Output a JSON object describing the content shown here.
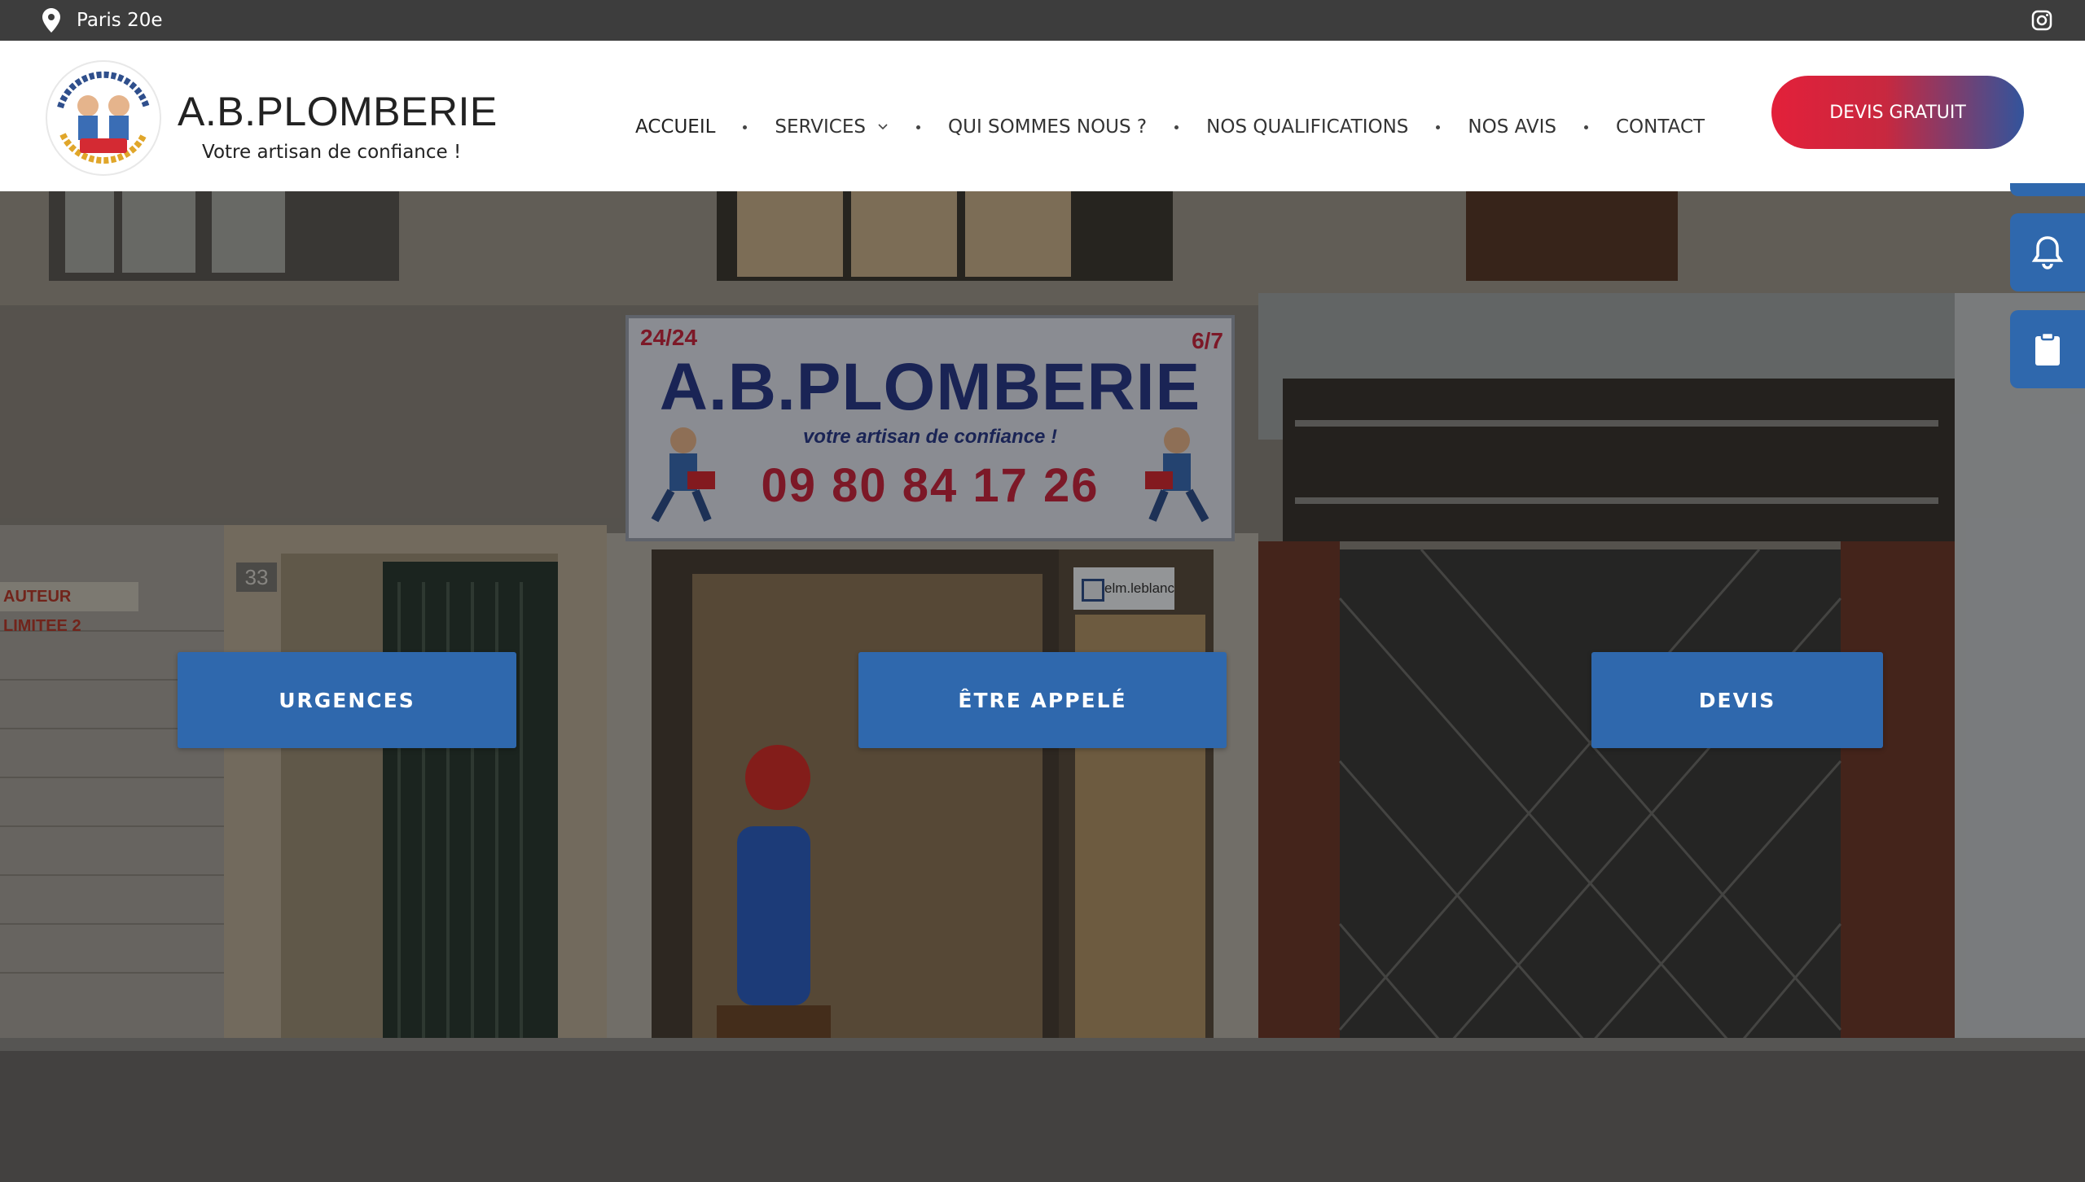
{
  "topbar": {
    "location": "Paris 20e",
    "location_icon": "map-pin-icon",
    "social_icon": "instagram-icon"
  },
  "header": {
    "logo_title": "A.B.PLOMBERIE",
    "logo_subtitle": "Votre artisan de confiance !",
    "nav": [
      {
        "label": "ACCUEIL"
      },
      {
        "label": "SERVICES"
      },
      {
        "label": "QUI SOMMES NOUS ?"
      },
      {
        "label": "NOS QUALIFICATIONS"
      },
      {
        "label": "NOS AVIS"
      },
      {
        "label": "CONTACT"
      }
    ],
    "cta_label": "DEVIS GRATUIT"
  },
  "hero": {
    "sign": {
      "top_left": "24/24",
      "top_right": "6/7",
      "brand": "A.B.PLOMBERIE",
      "tagline": "votre artisan de confiance !",
      "phone": "09 80 84 17 26"
    },
    "street_number": "33",
    "height_sign": "AUTEUR LIMITEE 2",
    "door_label": "elm.leblanc",
    "buttons": [
      {
        "label": "URGENCES"
      },
      {
        "label": "ÊTRE APPELÉ"
      },
      {
        "label": "DEVIS"
      }
    ]
  },
  "floating_tabs": [
    {
      "icon": "bell-icon"
    },
    {
      "icon": "clipboard-icon"
    }
  ],
  "colors": {
    "topbar": "#3d3d3d",
    "accent_blue": "#2f68ad",
    "accent_red": "#e3203a",
    "cta_gradient_end": "#32549c"
  }
}
